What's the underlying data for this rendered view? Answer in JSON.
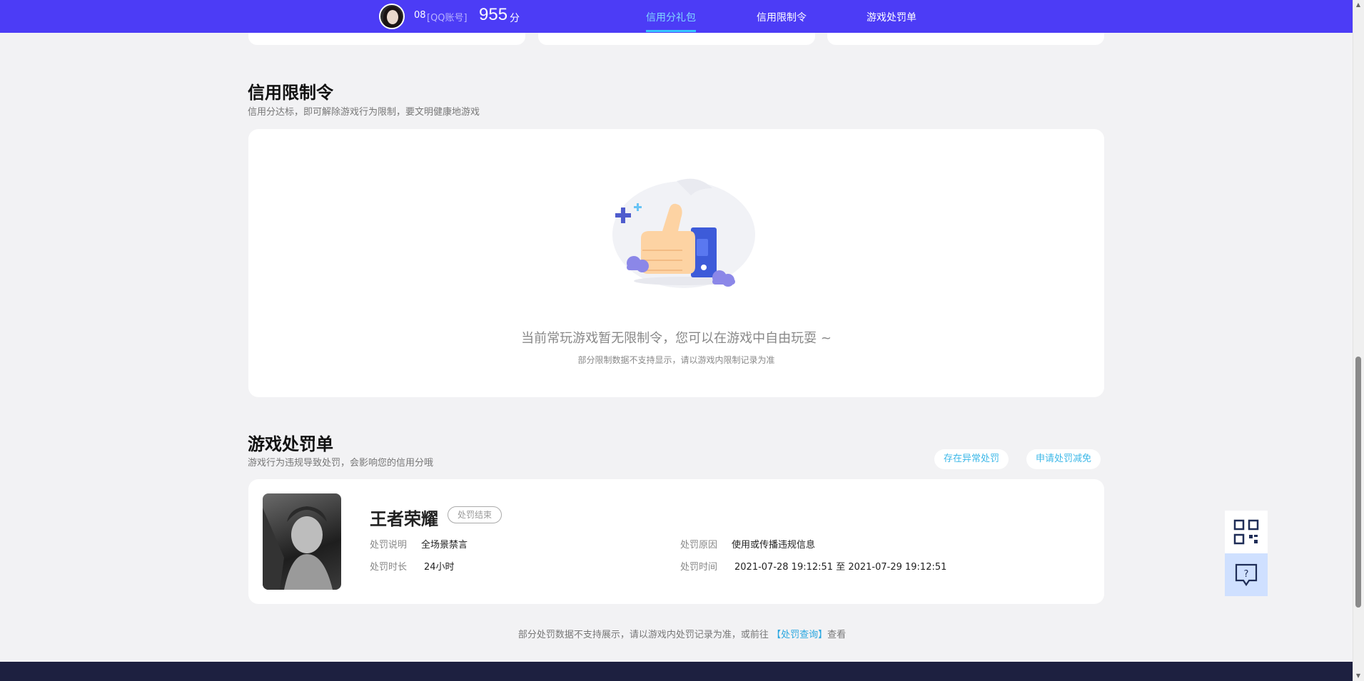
{
  "header": {
    "user_name": "08",
    "account_type": "[QQ账号]",
    "score": "955",
    "score_unit": "分",
    "nav": [
      "信用分礼包",
      "信用限制令",
      "游戏处罚单"
    ],
    "active_nav": "信用分礼包",
    "accent_color": "#4c3cf6"
  },
  "restriction": {
    "title": "信用限制令",
    "subtitle": "信用分达标，即可解除游戏行为限制，要文明健康地游戏",
    "empty_message": "当前常玩游戏暂无限制令，您可以在游戏中自由玩耍 ~",
    "empty_note": "部分限制数据不支持显示，请以游戏内限制记录为准"
  },
  "penalty": {
    "title": "游戏处罚单",
    "subtitle": "游戏行为违规导致处罚，会影响您的信用分哦",
    "btn_abnormal": "存在异常处罚",
    "btn_reduce": "申请处罚减免",
    "card": {
      "game_name": "王者荣耀",
      "status": "处罚结束",
      "desc_label": "处罚说明",
      "desc_value": "全场景禁言",
      "reason_label": "处罚原因",
      "reason_value": "使用或传播违规信息",
      "duration_label": "处罚时长",
      "duration_value": "24小时",
      "time_label": "处罚时间",
      "time_value": "2021-07-28 19:12:51 至 2021-07-29 19:12:51"
    },
    "footer_note_prefix": "部分处罚数据不支持展示，请以游戏内处罚记录为准，或前往",
    "footer_link": "【处罚查询】",
    "footer_note_suffix": "查看"
  },
  "icons": {
    "qrcode": "qrcode-icon",
    "feedback": "feedback-icon"
  }
}
